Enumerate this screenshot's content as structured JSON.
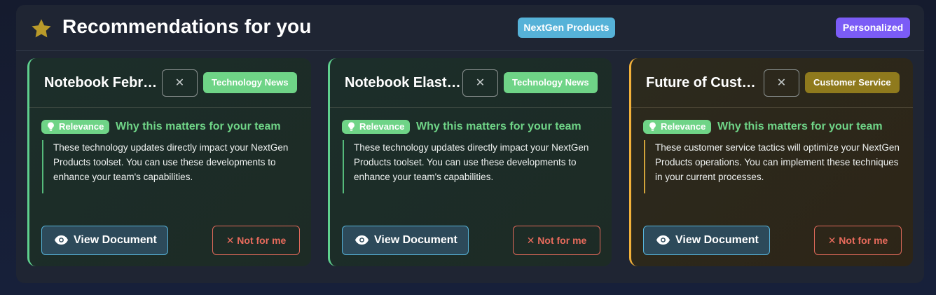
{
  "header": {
    "title": "Recommendations for you",
    "icon": "star-icon",
    "source_badge": "NextGen Products",
    "personalized_badge": "Personalized"
  },
  "colors": {
    "star": "#b99a2a",
    "tech_accent": "#6fd487",
    "service_accent": "#f2b13a",
    "view_border": "#56b2d8",
    "dismiss": "#e86b5c",
    "personalized": "#7b5cf6"
  },
  "cards": [
    {
      "title": "Notebook February...",
      "close_label": "✕",
      "category": "Technology News",
      "relevance_label": "Relevance",
      "why_heading": "Why this matters for your team",
      "body": "These technology updates directly impact your NextGen Products toolset. You can use these developments to enhance your team's capabilities.",
      "view_label": "View Document",
      "dismiss_label": "✕  Not for me"
    },
    {
      "title": "Notebook Elastic...",
      "close_label": "✕",
      "category": "Technology News",
      "relevance_label": "Relevance",
      "why_heading": "Why this matters for your team",
      "body": "These technology updates directly impact your NextGen Products toolset. You can use these developments to enhance your team's capabilities.",
      "view_label": "View Document",
      "dismiss_label": "✕  Not for me"
    },
    {
      "title": "Future of Customer...",
      "close_label": "✕",
      "category": "Customer Service",
      "relevance_label": "Relevance",
      "why_heading": "Why this matters for your team",
      "body": "These customer service tactics will optimize your NextGen Products operations. You can implement these techniques in your current processes.",
      "view_label": "View Document",
      "dismiss_label": "✕  Not for me"
    }
  ]
}
